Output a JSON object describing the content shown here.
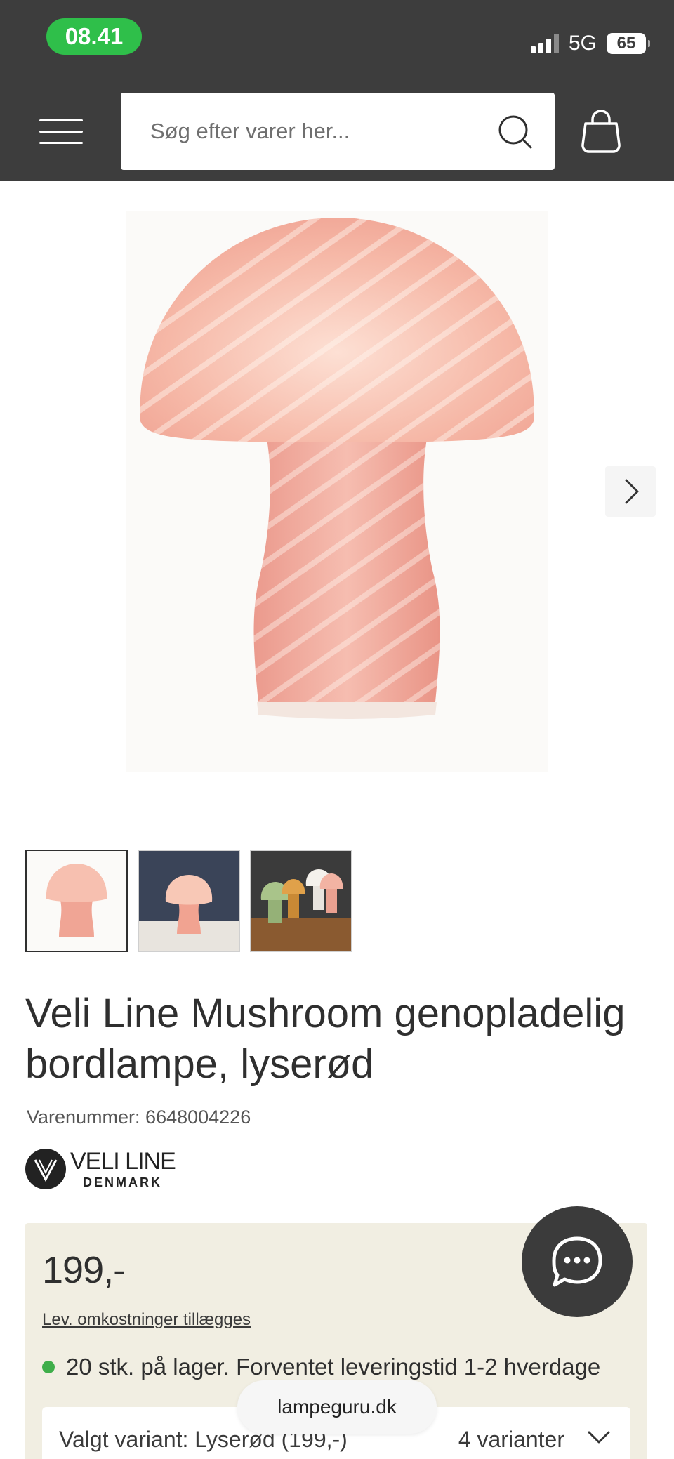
{
  "status_bar": {
    "time": "08.41",
    "network": "5G",
    "battery": "65"
  },
  "header": {
    "search_placeholder": "Søg efter varer her..."
  },
  "product": {
    "title": "Veli Line Mushroom genopladelig bordlampe, lyserød",
    "sku": "Varenummer: 6648004226",
    "brand_name": "VELI LINE",
    "brand_sub": "DENMARK"
  },
  "purchase": {
    "price": "199,-",
    "shipping_note": "Lev. omkostninger tillægges",
    "stock": "20 stk. på lager.  Forventet leveringstid 1-2 hverdage",
    "variant_label": "Valgt variant: Lyserød (199,-)",
    "variant_count": "4 varianter"
  },
  "footer": {
    "site": "lampeguru.dk"
  },
  "colors": {
    "header_bg": "#3d3d3d",
    "accent_green": "#2fbf4a",
    "buy_box_bg": "#f1eee2",
    "lamp_pink": "#f2a99c"
  }
}
